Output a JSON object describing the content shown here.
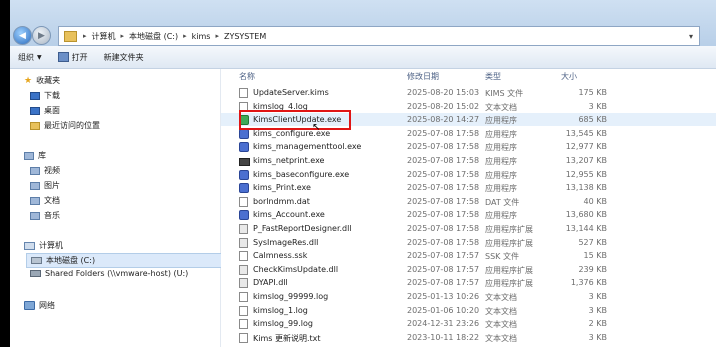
{
  "address": {
    "crumbs": [
      "计算机",
      "本地磁盘 (C:)",
      "kims",
      "ZYSYSTEM"
    ]
  },
  "toolbar": {
    "organize_label": "组织",
    "open_label": "打开",
    "new_folder_label": "新建文件夹"
  },
  "sidebar": {
    "favorites": "收藏夹",
    "downloads": "下载",
    "desktop": "桌面",
    "recent": "最近访问的位置",
    "libraries": "库",
    "videos": "视频",
    "pictures": "图片",
    "documents": "文档",
    "music": "音乐",
    "computer": "计算机",
    "local_disk": "本地磁盘 (C:)",
    "shared_folders": "Shared Folders (\\\\vmware-host) (U:)",
    "network": "网络"
  },
  "columns": {
    "name": "名称",
    "date": "修改日期",
    "type": "类型",
    "size": "大小"
  },
  "files": [
    {
      "name": "UpdateServer.kims",
      "date": "2025-08-20 15:03",
      "type": "KIMS 文件",
      "size": "175 KB",
      "icon": "doc"
    },
    {
      "name": "kimslog_4.log",
      "date": "2025-08-20 15:02",
      "type": "文本文档",
      "size": "3 KB",
      "icon": "doc"
    },
    {
      "name": "KimsClientUpdate.exe",
      "date": "2025-08-20 14:27",
      "type": "应用程序",
      "size": "685 KB",
      "icon": "exe-green"
    },
    {
      "name": "kims_configure.exe",
      "date": "2025-07-08 17:58",
      "type": "应用程序",
      "size": "13,545 KB",
      "icon": "exe"
    },
    {
      "name": "kims_managementtool.exe",
      "date": "2025-07-08 17:58",
      "type": "应用程序",
      "size": "12,977 KB",
      "icon": "exe"
    },
    {
      "name": "kims_netprint.exe",
      "date": "2025-07-08 17:58",
      "type": "应用程序",
      "size": "13,207 KB",
      "icon": "printer"
    },
    {
      "name": "kims_baseconfigure.exe",
      "date": "2025-07-08 17:58",
      "type": "应用程序",
      "size": "12,955 KB",
      "icon": "exe"
    },
    {
      "name": "kims_Print.exe",
      "date": "2025-07-08 17:58",
      "type": "应用程序",
      "size": "13,138 KB",
      "icon": "exe"
    },
    {
      "name": "borlndmm.dat",
      "date": "2025-07-08 17:58",
      "type": "DAT 文件",
      "size": "40 KB",
      "icon": "doc"
    },
    {
      "name": "kims_Account.exe",
      "date": "2025-07-08 17:58",
      "type": "应用程序",
      "size": "13,680 KB",
      "icon": "exe"
    },
    {
      "name": "P_FastReportDesigner.dll",
      "date": "2025-07-08 17:58",
      "type": "应用程序扩展",
      "size": "13,144 KB",
      "icon": "dll"
    },
    {
      "name": "SysImageRes.dll",
      "date": "2025-07-08 17:58",
      "type": "应用程序扩展",
      "size": "527 KB",
      "icon": "dll"
    },
    {
      "name": "Calmness.ssk",
      "date": "2025-07-08 17:57",
      "type": "SSK 文件",
      "size": "15 KB",
      "icon": "doc"
    },
    {
      "name": "CheckKimsUpdate.dll",
      "date": "2025-07-08 17:57",
      "type": "应用程序扩展",
      "size": "239 KB",
      "icon": "dll"
    },
    {
      "name": "DYAPI.dll",
      "date": "2025-07-08 17:57",
      "type": "应用程序扩展",
      "size": "1,376 KB",
      "icon": "dll"
    },
    {
      "name": "kimslog_99999.log",
      "date": "2025-01-13 10:26",
      "type": "文本文档",
      "size": "3 KB",
      "icon": "doc"
    },
    {
      "name": "kimslog_1.log",
      "date": "2025-01-06 10:20",
      "type": "文本文档",
      "size": "3 KB",
      "icon": "doc"
    },
    {
      "name": "kimslog_99.log",
      "date": "2024-12-31 23:26",
      "type": "文本文档",
      "size": "2 KB",
      "icon": "doc"
    },
    {
      "name": "Kims 更新说明.txt",
      "date": "2023-10-11 18:22",
      "type": "文本文档",
      "size": "3 KB",
      "icon": "doc"
    }
  ]
}
